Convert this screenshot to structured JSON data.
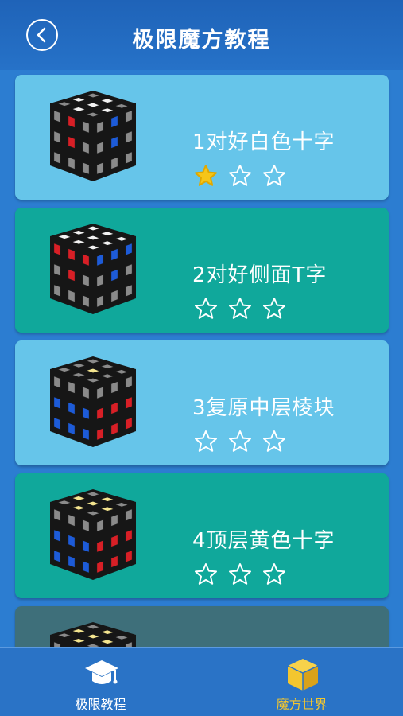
{
  "header": {
    "title": "极限魔方教程"
  },
  "lessons": [
    {
      "title": "1对好白色十字",
      "rating": 1,
      "max_rating": 3
    },
    {
      "title": "2对好侧面T字",
      "rating": 0,
      "max_rating": 3
    },
    {
      "title": "3复原中层棱块",
      "rating": 0,
      "max_rating": 3
    },
    {
      "title": "4顶层黄色十字",
      "rating": 0,
      "max_rating": 3
    }
  ],
  "tabs": [
    {
      "label": "极限教程",
      "icon": "graduation-cap-icon",
      "active": false
    },
    {
      "label": "魔方世界",
      "icon": "cube-icon",
      "active": true
    }
  ],
  "colors": {
    "header": "#1f63b8",
    "background": "#2c7dd1",
    "card_light": "#66c5ea",
    "card_teal": "#10a89b",
    "star_filled": "#f5c518",
    "active_tab": "#f3c62f"
  }
}
